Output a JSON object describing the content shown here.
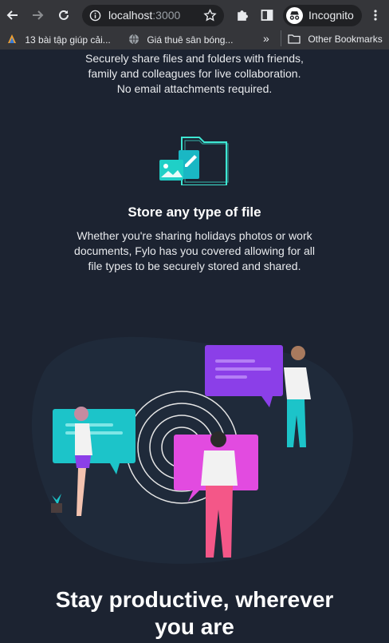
{
  "browser": {
    "url_host": "localhost",
    "url_port": ":3000",
    "incognito_label": "Incognito",
    "bookmarks": [
      {
        "label": "13 bài tập giúp cải..."
      },
      {
        "label": "Giá thuê sân bóng..."
      }
    ],
    "bookmarks_overflow": "»",
    "other_bookmarks": "Other Bookmarks"
  },
  "page": {
    "intro_lines": [
      "Securely share files and folders with friends,",
      "family and colleagues for live collaboration.",
      "No email attachments required."
    ],
    "feature": {
      "title": "Store any type of file",
      "description": "Whether you're sharing holidays photos or work documents, Fylo has you covered allowing for all file types to be securely stored and shared."
    },
    "headline": "Stay productive, wherever you are"
  },
  "colors": {
    "background": "#1c2331",
    "accent_cyan": "#3ee7d3",
    "chrome": "#35363a"
  }
}
